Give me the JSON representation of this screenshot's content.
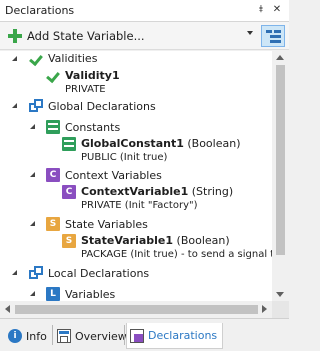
{
  "panel": {
    "title": "Declarations",
    "pin_glyph": "⯒",
    "close_glyph": "✕"
  },
  "toolbar": {
    "add_label": "Add State Variable...",
    "add_icon": "plus-icon",
    "view_icon": "tree-view-icon"
  },
  "tree": {
    "validities": {
      "label": "Validities",
      "icon": "checkmark-icon"
    },
    "validity1": {
      "name": "Validity1",
      "detail": "PRIVATE",
      "icon": "checkmark-icon"
    },
    "global_declarations": {
      "label": "Global Declarations",
      "icon": "global-declarations-icon"
    },
    "constants": {
      "label": "Constants",
      "icon": "constant-icon"
    },
    "global_constant1": {
      "name": "GlobalConstant1",
      "type": "(Boolean)",
      "detail": "PUBLIC (Init true)"
    },
    "context_variables": {
      "label": "Context Variables",
      "icon_letter": "C"
    },
    "context_variable1": {
      "name": "ContextVariable1",
      "type": "(String)",
      "detail": "PRIVATE (Init \"Factory\")",
      "icon_letter": "C"
    },
    "state_variables": {
      "label": "State Variables",
      "icon_letter": "S"
    },
    "state_variable1": {
      "name": "StateVariable1",
      "type": "(Boolean)",
      "detail": "PACKAGE (Init true) - to send a signal to",
      "icon_letter": "S"
    },
    "local_declarations": {
      "label": "Local Declarations",
      "icon": "local-declarations-icon"
    },
    "variables": {
      "label": "Variables",
      "icon_letter": "L"
    }
  },
  "tabs": [
    {
      "label": "Info",
      "icon": "info-icon",
      "glyph": "i"
    },
    {
      "label": "Overview",
      "icon": "overview-icon"
    },
    {
      "label": "Declarations",
      "icon": "declarations-icon",
      "active": true
    }
  ],
  "colors": {
    "accent": "#2b78c4",
    "green": "#3aa64a",
    "constant_green": "#2f9e5b",
    "context_purple": "#8a4ec0",
    "state_orange": "#e8a640"
  }
}
